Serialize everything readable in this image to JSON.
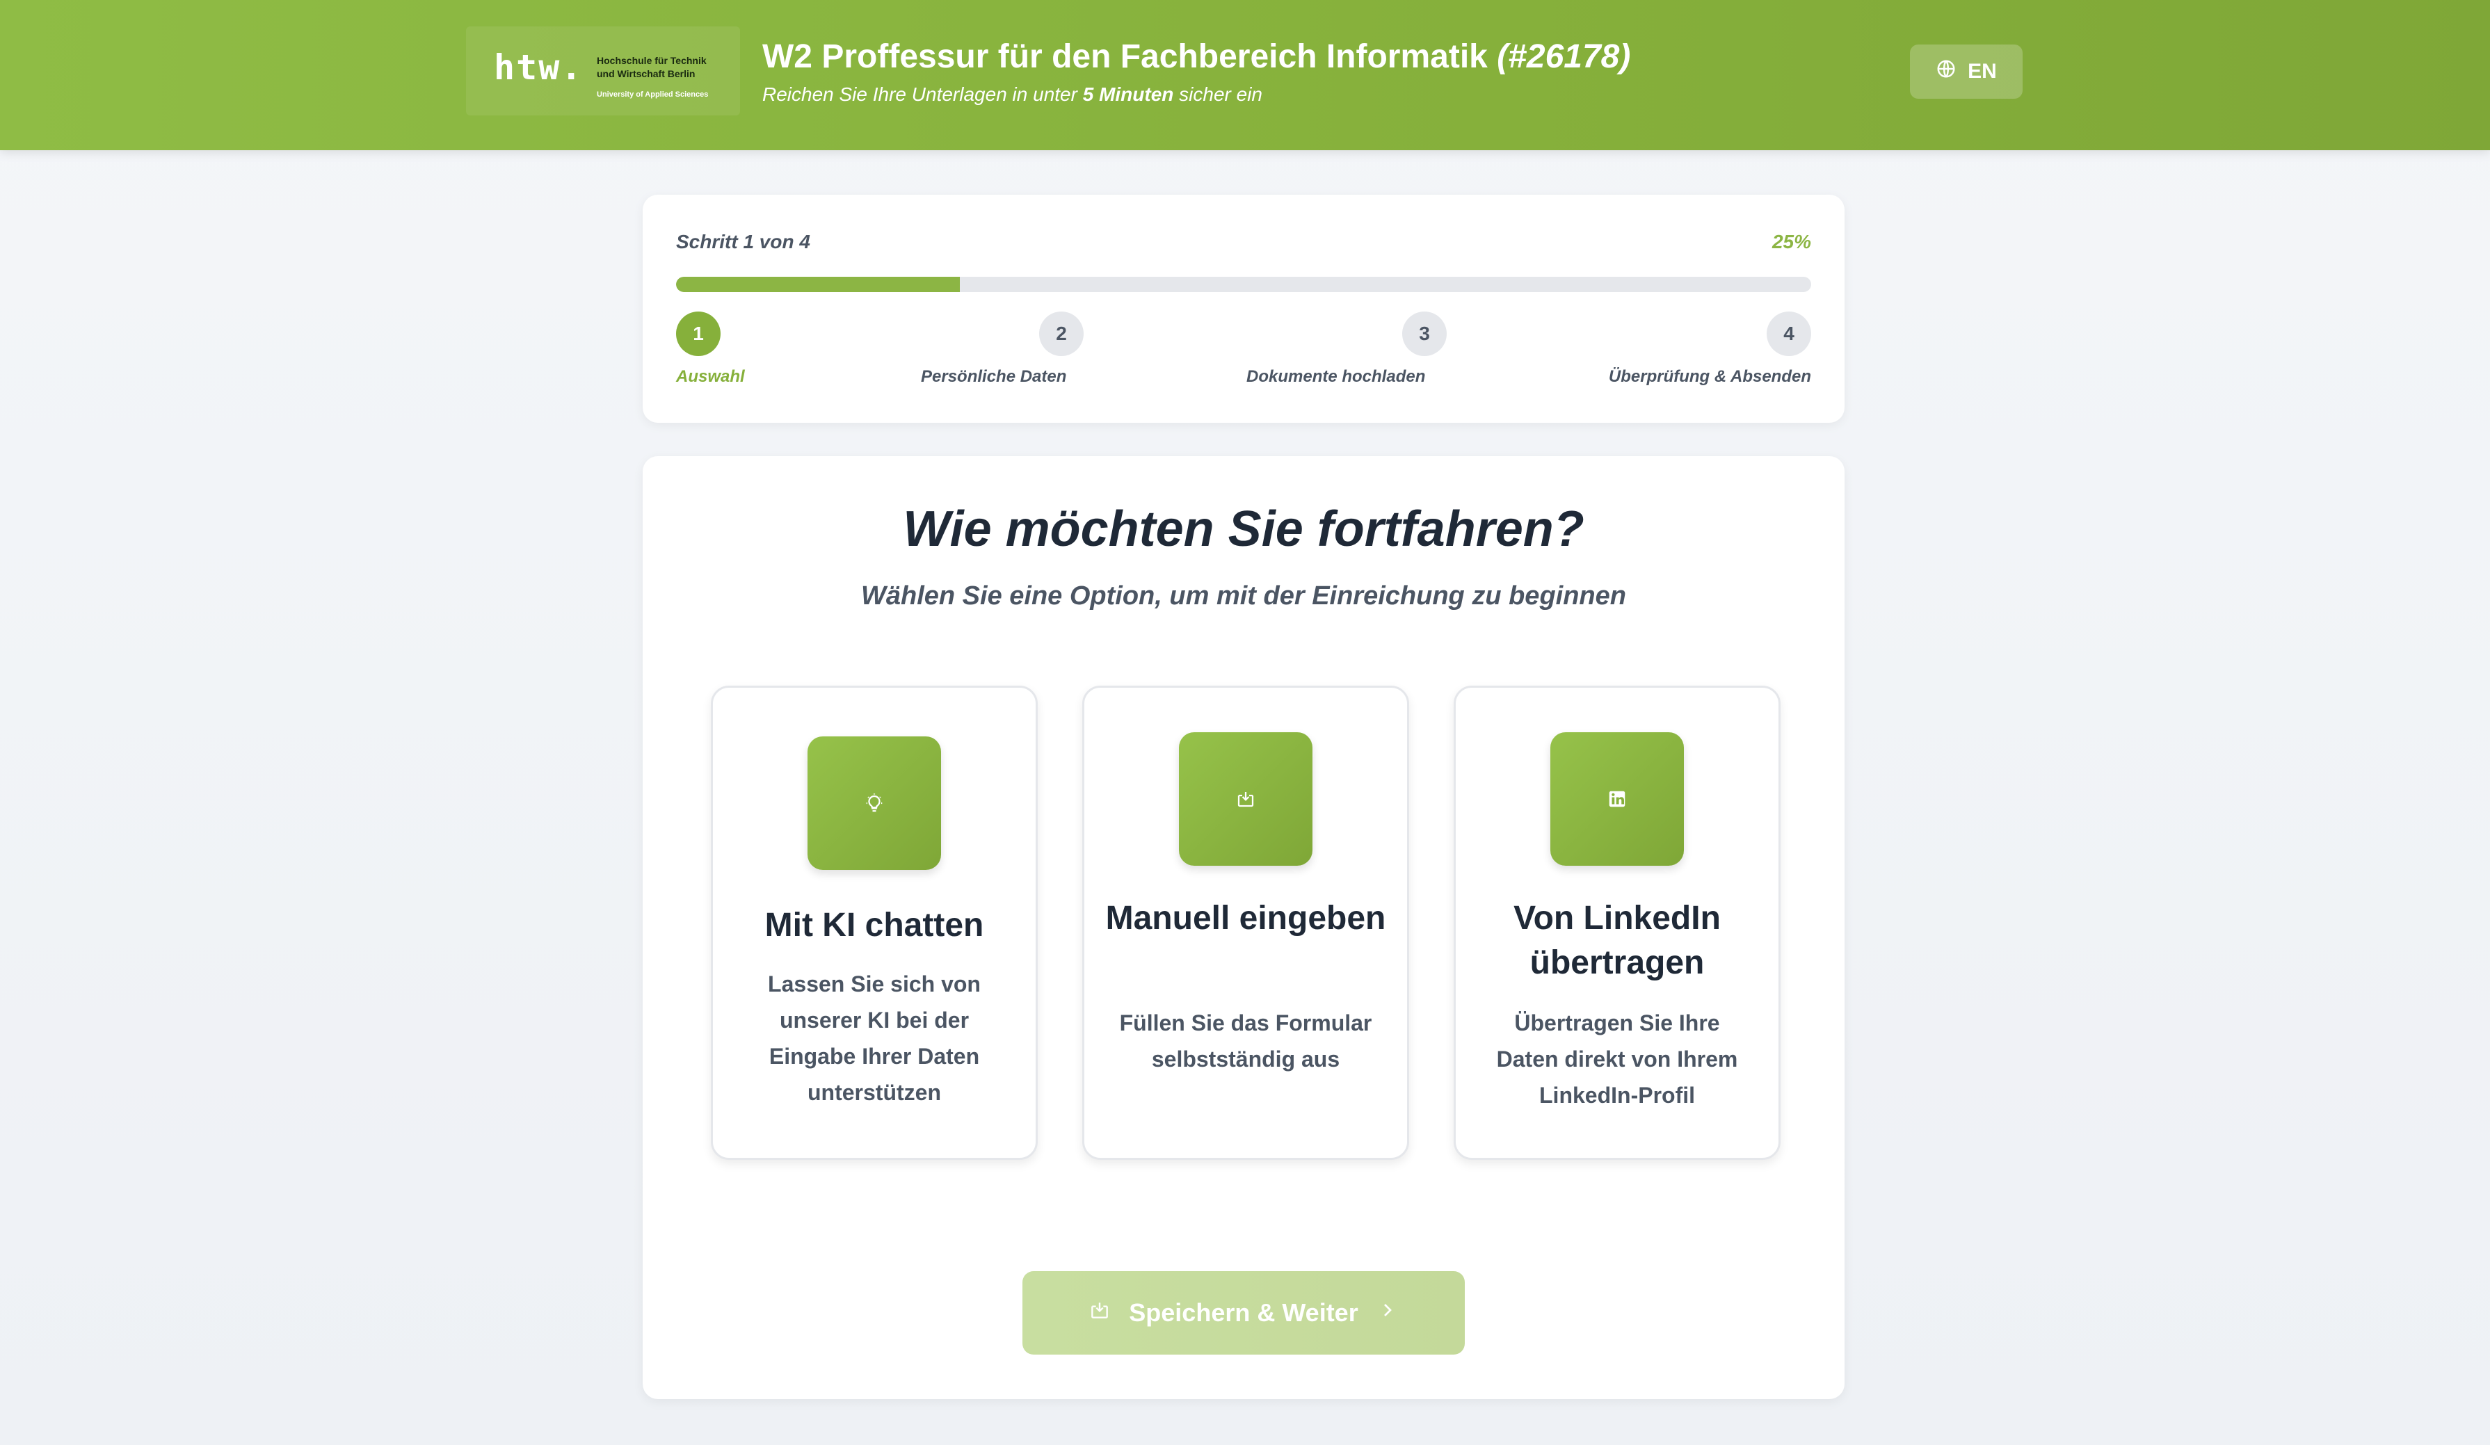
{
  "header": {
    "logo_mark": "htw.",
    "logo_line1": "Hochschule für Technik",
    "logo_line2": "und Wirtschaft Berlin",
    "logo_line3": "University of Applied Sciences",
    "title": "W2 Proffessur für den Fachbereich Informatik",
    "job_id": "(#26178)",
    "subtitle_before": "Reichen Sie Ihre Unterlagen in unter",
    "subtitle_bold": "5 Minuten",
    "subtitle_after": "sicher ein",
    "language_button": "EN",
    "language_icon": "globe-icon"
  },
  "progress": {
    "step_text": "Schritt 1 von 4",
    "percent_text": "25%",
    "progress_fraction": 0.25,
    "steps": [
      {
        "number": "1",
        "label": "Auswahl",
        "active": true
      },
      {
        "number": "2",
        "label": "Persönliche Daten",
        "active": false
      },
      {
        "number": "3",
        "label": "Dokumente hochladen",
        "active": false
      },
      {
        "number": "4",
        "label": "Überprüfung & Absenden",
        "active": false
      }
    ],
    "colors": {
      "active": "#86b03b",
      "inactive": "#e5e7eb"
    }
  },
  "main": {
    "heading": "Wie möchten Sie fortfahren?",
    "subheading": "Wählen Sie eine Option, um mit der Einreichung zu beginnen",
    "options": [
      {
        "icon": "lightbulb-icon",
        "title": "Mit KI chatten",
        "description": "Lassen Sie sich von unserer KI bei der Eingabe Ihrer Daten unterstützen"
      },
      {
        "icon": "download-box-icon",
        "title": "Manuell eingeben",
        "description": "Füllen Sie das Formular selbstständig aus"
      },
      {
        "icon": "linkedin-icon",
        "title": "Von LinkedIn übertragen",
        "description": "Übertragen Sie Ihre Daten direkt von Ihrem LinkedIn-Profil"
      }
    ],
    "save_button": "Speichern & Weiter",
    "accent_color": "#8cb544"
  }
}
